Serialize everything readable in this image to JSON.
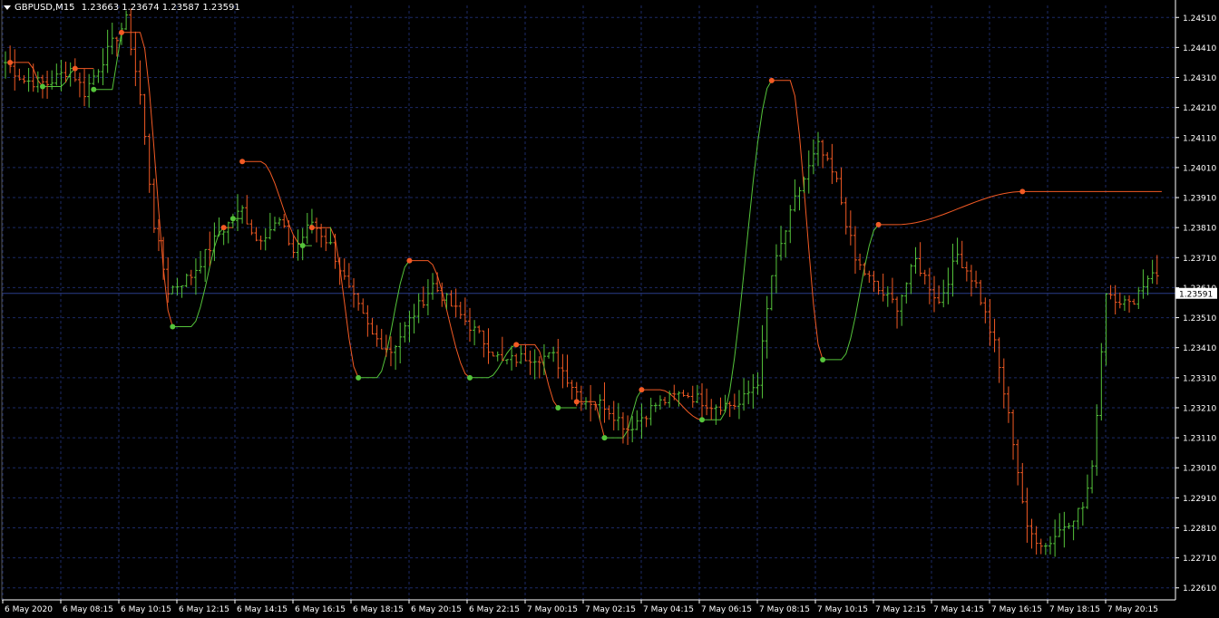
{
  "header": {
    "symbol": "GBPUSD,M15",
    "ohlc": "1.23663 1.23674 1.23587 1.23591"
  },
  "colors": {
    "background": "#000000",
    "grid": "#1c2a66",
    "axis": "#ffffff",
    "bull": "#55c43b",
    "bear": "#f25a24",
    "price_line": "#2b3e8a",
    "label_bg": "#ffffff"
  },
  "chart_data": {
    "type": "bar",
    "symbol": "GBPUSD",
    "timeframe": "M15",
    "ylim": [
      1.2257,
      1.2455
    ],
    "y_ticks": [
      "1.24510",
      "1.24410",
      "1.24310",
      "1.24210",
      "1.24110",
      "1.24010",
      "1.23910",
      "1.23810",
      "1.23710",
      "1.23610",
      "1.23510",
      "1.23410",
      "1.23310",
      "1.23210",
      "1.23110",
      "1.23010",
      "1.22910",
      "1.22810",
      "1.22710",
      "1.22610"
    ],
    "x_ticks": [
      "6 May 2020",
      "6 May 08:15",
      "6 May 10:15",
      "6 May 12:15",
      "6 May 14:15",
      "6 May 16:15",
      "6 May 18:15",
      "6 May 20:15",
      "6 May 22:15",
      "7 May 00:15",
      "7 May 02:15",
      "7 May 04:15",
      "7 May 06:15",
      "7 May 08:15",
      "7 May 10:15",
      "7 May 12:15",
      "7 May 14:15",
      "7 May 16:15",
      "7 May 18:15",
      "7 May 20:15"
    ],
    "current_price": "1.23591",
    "grid": true,
    "price_anchors": [
      [
        0,
        1.2436
      ],
      [
        4,
        1.243
      ],
      [
        9,
        1.2429
      ],
      [
        14,
        1.2434
      ],
      [
        17,
        1.2426
      ],
      [
        21,
        1.2437
      ],
      [
        26,
        1.245
      ],
      [
        29,
        1.2425
      ],
      [
        32,
        1.2382
      ],
      [
        35,
        1.236
      ],
      [
        40,
        1.2365
      ],
      [
        46,
        1.2379
      ],
      [
        51,
        1.2387
      ],
      [
        54,
        1.2377
      ],
      [
        59,
        1.2383
      ],
      [
        62,
        1.2373
      ],
      [
        66,
        1.2383
      ],
      [
        70,
        1.2375
      ],
      [
        74,
        1.236
      ],
      [
        79,
        1.2345
      ],
      [
        83,
        1.234
      ],
      [
        87,
        1.235
      ],
      [
        92,
        1.2362
      ],
      [
        96,
        1.2355
      ],
      [
        102,
        1.2345
      ],
      [
        107,
        1.2336
      ],
      [
        112,
        1.2338
      ],
      [
        118,
        1.2338
      ],
      [
        124,
        1.2324
      ],
      [
        129,
        1.2322
      ],
      [
        134,
        1.2314
      ],
      [
        140,
        1.2322
      ],
      [
        146,
        1.2326
      ],
      [
        152,
        1.2322
      ],
      [
        158,
        1.2322
      ],
      [
        162,
        1.233
      ],
      [
        165,
        1.2365
      ],
      [
        170,
        1.239
      ],
      [
        175,
        1.2408
      ],
      [
        179,
        1.2396
      ],
      [
        183,
        1.237
      ],
      [
        188,
        1.236
      ],
      [
        192,
        1.2355
      ],
      [
        196,
        1.237
      ],
      [
        201,
        1.2356
      ],
      [
        205,
        1.2372
      ],
      [
        209,
        1.2362
      ],
      [
        213,
        1.2342
      ],
      [
        217,
        1.231
      ],
      [
        220,
        1.228
      ],
      [
        224,
        1.2275
      ],
      [
        228,
        1.2282
      ],
      [
        232,
        1.2288
      ],
      [
        234,
        1.23
      ],
      [
        237,
        1.236
      ],
      [
        242,
        1.2355
      ],
      [
        247,
        1.2367
      ],
      [
        250,
        1.2358
      ]
    ],
    "signals": [
      {
        "type": "down",
        "bar": 1,
        "price": 1.2436
      },
      {
        "type": "up",
        "bar": 8,
        "price": 1.2428
      },
      {
        "type": "down",
        "bar": 15,
        "price": 1.2434
      },
      {
        "type": "up",
        "bar": 19,
        "price": 1.2427
      },
      {
        "type": "down",
        "bar": 25,
        "price": 1.2446
      },
      {
        "type": "up",
        "bar": 36,
        "price": 1.2348
      },
      {
        "type": "down",
        "bar": 47,
        "price": 1.2381
      },
      {
        "type": "up",
        "bar": 49,
        "price": 1.2384
      },
      {
        "type": "down",
        "bar": 51,
        "price": 1.2403
      },
      {
        "type": "up",
        "bar": 64,
        "price": 1.2375
      },
      {
        "type": "down",
        "bar": 66,
        "price": 1.2381
      },
      {
        "type": "up",
        "bar": 76,
        "price": 1.2331
      },
      {
        "type": "down",
        "bar": 87,
        "price": 1.237
      },
      {
        "type": "up",
        "bar": 100,
        "price": 1.2331
      },
      {
        "type": "down",
        "bar": 110,
        "price": 1.2342
      },
      {
        "type": "up",
        "bar": 119,
        "price": 1.2321
      },
      {
        "type": "down",
        "bar": 123,
        "price": 1.2323
      },
      {
        "type": "up",
        "bar": 129,
        "price": 1.2311
      },
      {
        "type": "down",
        "bar": 137,
        "price": 1.2327
      },
      {
        "type": "up",
        "bar": 150,
        "price": 1.2317
      },
      {
        "type": "down",
        "bar": 165,
        "price": 1.243
      },
      {
        "type": "up",
        "bar": 176,
        "price": 1.2337
      },
      {
        "type": "down",
        "bar": 188,
        "price": 1.2382
      },
      {
        "type": "down",
        "bar": 219,
        "price": 1.2393
      }
    ]
  }
}
